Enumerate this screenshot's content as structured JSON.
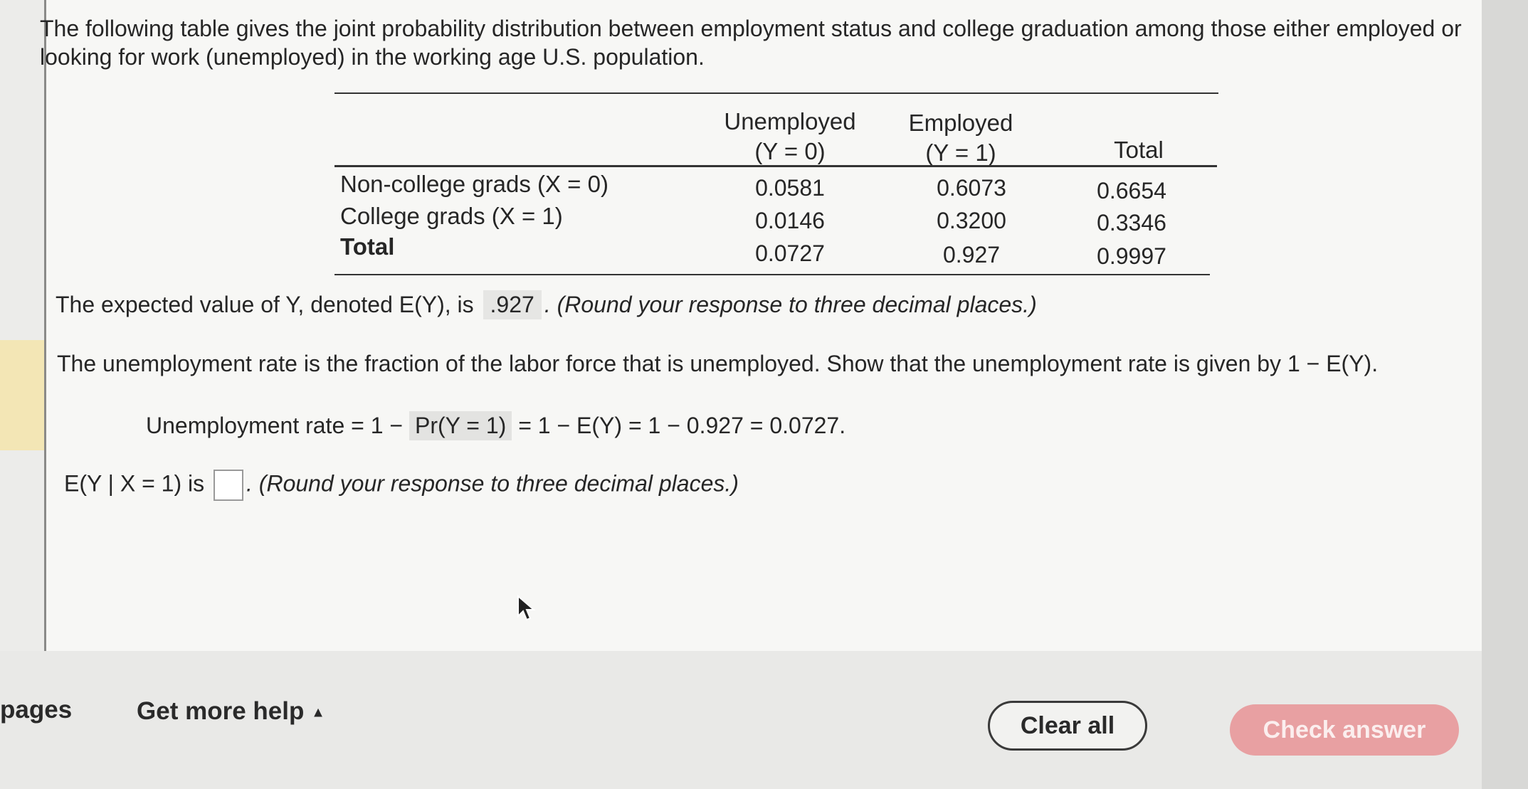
{
  "intro": "The following table gives the joint probability distribution between employment status and college graduation among those either employed or looking for work (unemployed) in the working age U.S. population.",
  "table": {
    "headers": [
      {
        "line1": "Unemployed",
        "line2": "(Y = 0)"
      },
      {
        "line1": "Employed",
        "line2": "(Y = 1)"
      },
      {
        "line1": "Total",
        "line2": ""
      }
    ],
    "rows": [
      {
        "label": "Non-college grads (X = 0)",
        "values": [
          "0.0581",
          "0.6073",
          "0.6654"
        ]
      },
      {
        "label": "College grads (X = 1)",
        "values": [
          "0.0146",
          "0.3200",
          "0.3346"
        ]
      },
      {
        "label": "Total",
        "values": [
          "0.0727",
          "0.927",
          "0.9997"
        ]
      }
    ]
  },
  "q1": {
    "prefix": "The expected value of Y, denoted E(Y), is",
    "answer": ".927",
    "suffix": ". (Round your response to three decimal places.)"
  },
  "q2": {
    "text": "The unemployment rate is the fraction of the labor force that is unemployed. Show that the unemployment rate is given by 1 − E(Y)."
  },
  "formula": {
    "prefix": "Unemployment rate = 1 −",
    "highlight": "Pr(Y = 1)",
    "suffix": "= 1 − E(Y) = 1 − 0.927 = 0.0727."
  },
  "q3": {
    "prefix": "E(Y | X = 1) is",
    "input_value": "",
    "suffix": ". (Round your response to three decimal places.)"
  },
  "footer": {
    "pages": "pages",
    "help": "Get more help",
    "clear": "Clear all",
    "check": "Check answer"
  },
  "colors": {
    "check_button": "#e8a0a2",
    "accent_bar": "#f3e6b5"
  }
}
